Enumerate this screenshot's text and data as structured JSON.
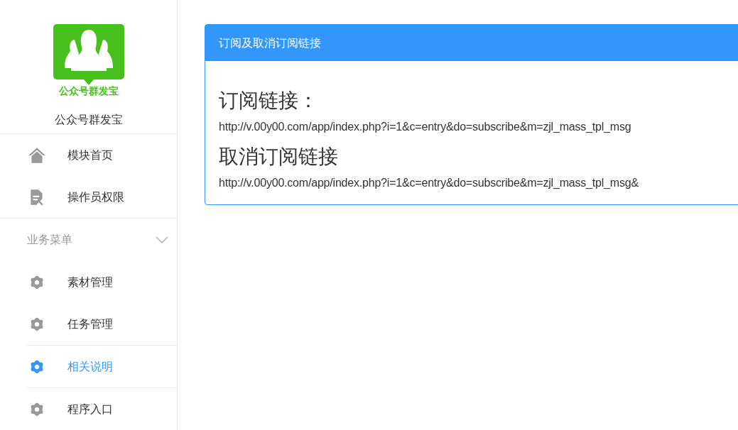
{
  "sidebar": {
    "logo": {
      "caption": "公众号群发宝"
    },
    "app_name": "公众号群发宝",
    "items": [
      {
        "label": "模块首页",
        "kind": "home",
        "selected": false
      },
      {
        "label": "操作员权限",
        "kind": "document",
        "selected": false
      }
    ],
    "section": {
      "title": "业务菜单",
      "expanded": true,
      "items": [
        {
          "label": "素材管理",
          "kind": "gear",
          "selected": false
        },
        {
          "label": "任务管理",
          "kind": "gear",
          "selected": false
        },
        {
          "label": "相关说明",
          "kind": "gear",
          "selected": true
        },
        {
          "label": "程序入口",
          "kind": "gear",
          "selected": false
        }
      ]
    }
  },
  "panel": {
    "title": "订阅及取消订阅链接",
    "entries": [
      {
        "heading": "订阅链接：",
        "url": "http://v.00y00.com/app/index.php?i=1&c=entry&do=subscribe&m=zjl_mass_tpl_msg"
      },
      {
        "heading": "取消订阅链接",
        "url": "http://v.00y00.com/app/index.php?i=1&c=entry&do=subscribe&m=zjl_mass_tpl_msg&"
      }
    ]
  }
}
